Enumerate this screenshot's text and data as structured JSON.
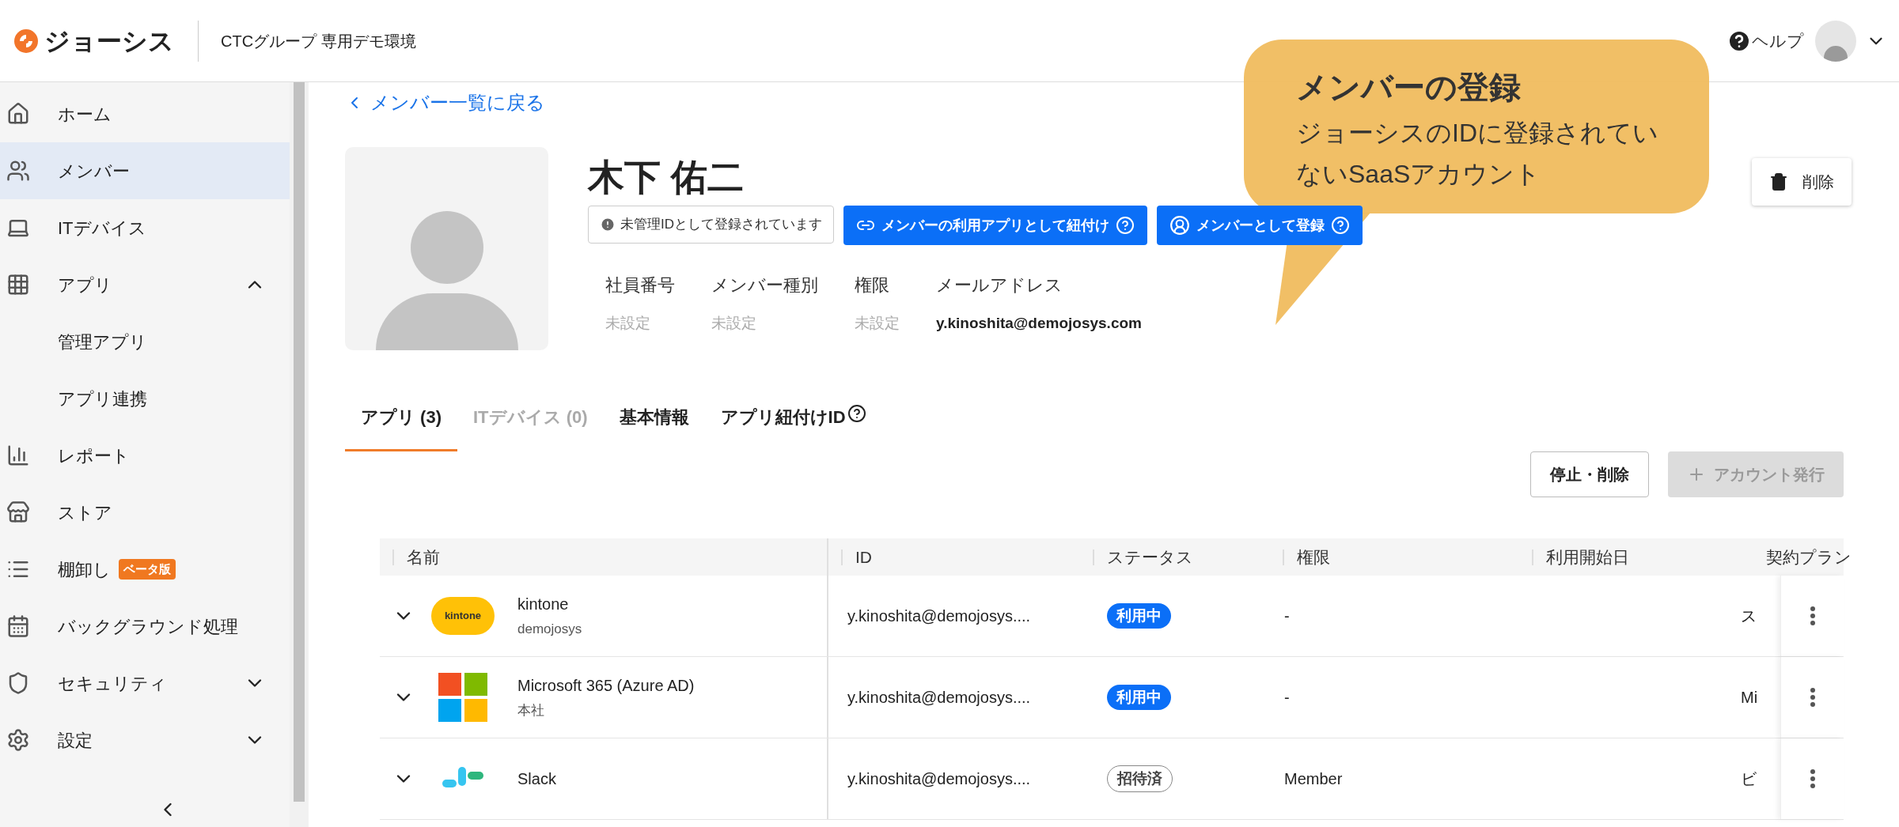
{
  "header": {
    "logo_text": "ジョーシス",
    "org": "CTCグループ 専用デモ環境",
    "help": "ヘルプ"
  },
  "sidebar": {
    "items": [
      {
        "label": "ホーム",
        "selected": false
      },
      {
        "label": "メンバー",
        "selected": true
      },
      {
        "label": "ITデバイス",
        "selected": false
      },
      {
        "label": "アプリ",
        "selected": false,
        "expanded": true,
        "children": [
          {
            "label": "管理アプリ",
            "selected": false
          },
          {
            "label": "アプリ連携",
            "selected": false
          }
        ]
      },
      {
        "label": "レポート",
        "selected": false
      },
      {
        "label": "ストア",
        "selected": false
      },
      {
        "label": "棚卸し",
        "selected": false,
        "badge": "ベータ版"
      },
      {
        "label": "バックグラウンド処理",
        "selected": false
      },
      {
        "label": "セキュリティ",
        "selected": false,
        "expanded": false
      },
      {
        "label": "設定",
        "selected": false,
        "expanded": false
      }
    ]
  },
  "back_link": "メンバー一覧に戻る",
  "profile": {
    "name": "木下 佑二",
    "status_badge": "未管理IDとして登録されています",
    "buttons": [
      {
        "label": "メンバーの利用アプリとして紐付け"
      },
      {
        "label": "メンバーとして登録"
      }
    ],
    "fields": [
      {
        "label": "社員番号",
        "value": "未設定",
        "set": false
      },
      {
        "label": "メンバー種別",
        "value": "未設定",
        "set": false
      },
      {
        "label": "権限",
        "value": "未設定",
        "set": false
      },
      {
        "label": "メールアドレス",
        "value": "y.kinoshita@demojosys.com",
        "set": true
      }
    ],
    "delete_button": "削除"
  },
  "tabs": [
    {
      "label": "アプリ (3)",
      "selected": true,
      "disabled": false,
      "help": false
    },
    {
      "label": "ITデバイス (0)",
      "selected": false,
      "disabled": true,
      "help": false
    },
    {
      "label": "基本情報",
      "selected": false,
      "disabled": false,
      "help": false
    },
    {
      "label": "アプリ紐付けID",
      "selected": false,
      "disabled": false,
      "help": true
    }
  ],
  "actions": [
    {
      "label": "停止・削除",
      "disabled": false
    },
    {
      "label": "アカウント発行",
      "disabled": true
    }
  ],
  "table": {
    "columns": [
      "名前",
      "ID",
      "ステータス",
      "権限",
      "利用開始日",
      "契約プラン"
    ],
    "rows": [
      {
        "name": "kintone",
        "logo_text": "kintone",
        "tenant": "demojosys",
        "id": "y.kinoshita@demojosys....",
        "status": "利用中",
        "active": true,
        "role": "-",
        "plan": "ス"
      },
      {
        "name": "Microsoft 365 (Azure AD)",
        "tenant": "本社",
        "id": "y.kinoshita@demojosys....",
        "status": "利用中",
        "active": true,
        "role": "-",
        "plan": "Mi"
      },
      {
        "name": "Slack",
        "id": "y.kinoshita@demojosys....",
        "status": "招待済",
        "active": false,
        "role": "Member",
        "plan": "ビ"
      }
    ]
  },
  "callout": {
    "title": "メンバーの登録",
    "body": "ジョーシスのIDに登録されていないSaaSアカウント"
  }
}
